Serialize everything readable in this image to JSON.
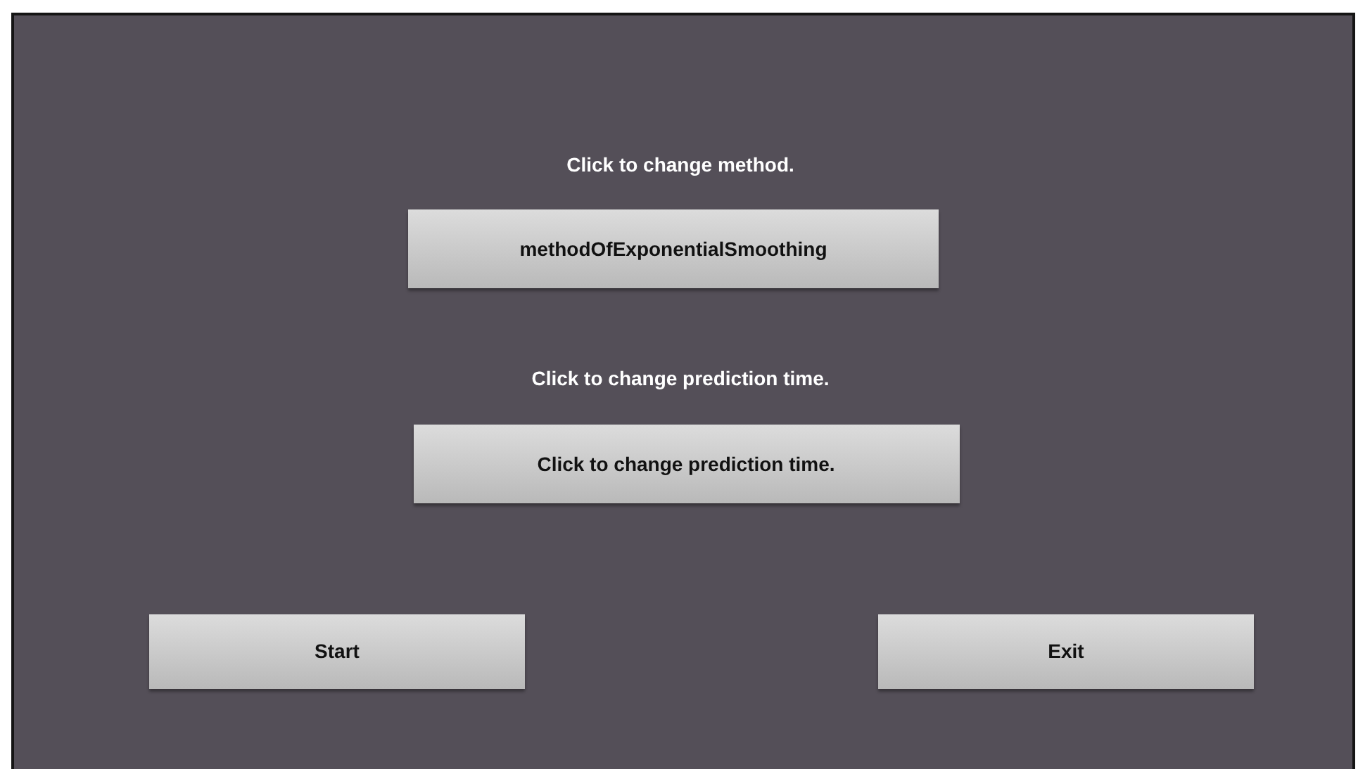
{
  "method": {
    "label": "Click to change method.",
    "button": "methodOfExponentialSmoothing"
  },
  "prediction": {
    "label": "Click to change prediction time.",
    "button": "Click to change prediction time."
  },
  "buttons": [
    {
      "label": "Start"
    },
    {
      "label": "Exit"
    }
  ]
}
